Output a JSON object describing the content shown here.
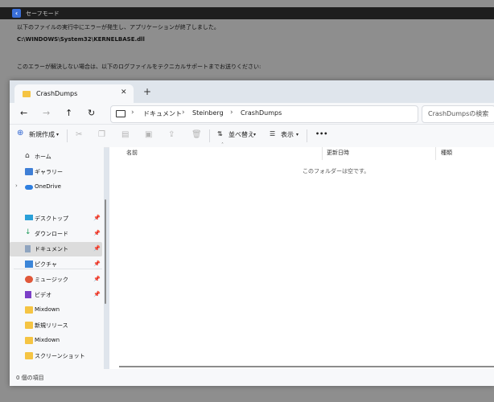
{
  "error_dialog": {
    "title": "セーフモード",
    "line1": "以下のファイルの実行中にエラーが発生し、アプリケーションが終了しました。",
    "path": "C:\\WINDOWS\\System32\\KERNELBASE.dll",
    "line2": "このエラーが解決しない場合は、以下のログファイルをテクニカルサポートまでお送りください:"
  },
  "explorer": {
    "tab_label": "CrashDumps",
    "new_tab": "+",
    "breadcrumb": [
      "ドキュメント",
      "Steinberg",
      "CrashDumps"
    ],
    "search_placeholder": "CrashDumpsの検索",
    "toolbar": {
      "new": "新規作成",
      "sort": "並べ替え",
      "view": "表示",
      "more": "•••"
    },
    "nav_items": [
      {
        "label": "ホーム",
        "icon": "home-icon"
      },
      {
        "label": "ギャラリー",
        "icon": "gallery-icon"
      },
      {
        "label": "OneDrive",
        "icon": "cloud-icon"
      },
      {
        "label": "デスクトップ",
        "icon": "desktop-icon"
      },
      {
        "label": "ダウンロード",
        "icon": "download-icon"
      },
      {
        "label": "ドキュメント",
        "icon": "document-icon"
      },
      {
        "label": "ピクチャ",
        "icon": "pictures-icon"
      },
      {
        "label": "ミュージック",
        "icon": "music-icon"
      },
      {
        "label": "ビデオ",
        "icon": "video-icon"
      },
      {
        "label": "Mixdown",
        "icon": "folder-icon"
      },
      {
        "label": "新規リリース",
        "icon": "folder-icon"
      },
      {
        "label": "Mixdown",
        "icon": "folder-icon"
      },
      {
        "label": "スクリーンショット",
        "icon": "folder-icon"
      }
    ],
    "columns": [
      "名前",
      "更新日時",
      "種類"
    ],
    "empty_message": "このフォルダーは空です。",
    "status": "0 個の項目"
  }
}
